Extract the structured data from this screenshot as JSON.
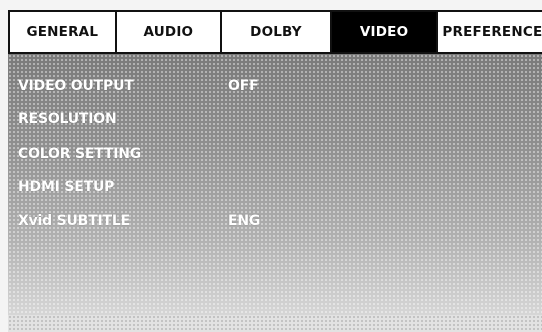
{
  "tabs": [
    {
      "label": "GENERAL",
      "active": false
    },
    {
      "label": "AUDIO",
      "active": false
    },
    {
      "label": "DOLBY",
      "active": false
    },
    {
      "label": "VIDEO",
      "active": true
    },
    {
      "label": "PREFERENCE",
      "active": false
    }
  ],
  "menu": {
    "items": [
      {
        "label": "VIDEO OUTPUT",
        "value": "OFF"
      },
      {
        "label": "RESOLUTION",
        "value": ""
      },
      {
        "label": "COLOR SETTING",
        "value": ""
      },
      {
        "label": "HDMI SETUP",
        "value": ""
      },
      {
        "label": "Xvid SUBTITLE",
        "value": "ENG"
      }
    ]
  },
  "colors": {
    "active_tab_bg": "#000000",
    "active_tab_text": "#ffffff",
    "tab_text": "#111111",
    "panel_bg": "#8e8e8e",
    "menu_text": "#ffffff"
  }
}
